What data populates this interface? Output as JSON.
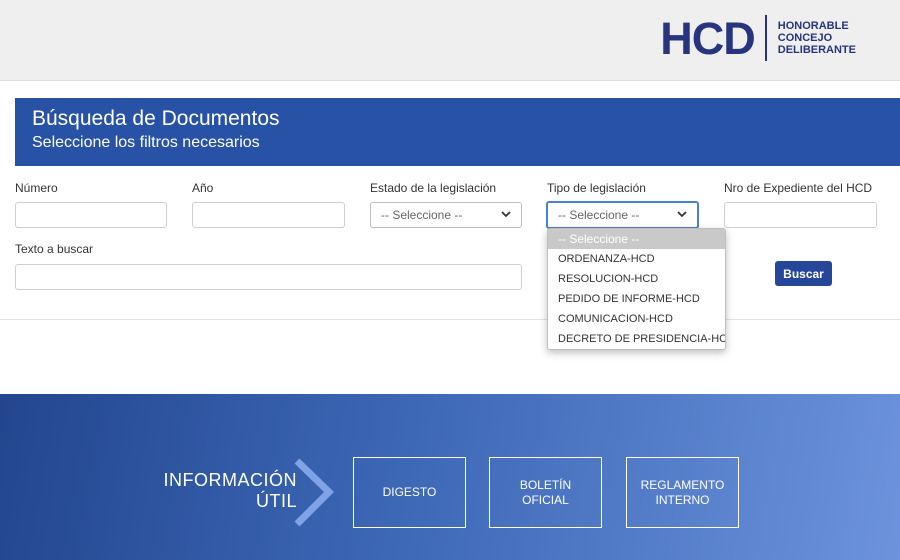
{
  "logo": {
    "mark": "HCD",
    "line1": "HONORABLE",
    "line2": "CONCEJO",
    "line3": "DELIBERANTE"
  },
  "banner": {
    "title": "Búsqueda de Documentos",
    "subtitle": "Seleccione los filtros necesarios"
  },
  "fields": {
    "numero": {
      "label": "Número",
      "value": ""
    },
    "anio": {
      "label": "Año",
      "value": ""
    },
    "estado": {
      "label": "Estado de la legislación",
      "selected": "-- Seleccione --"
    },
    "tipo": {
      "label": "Tipo de legislación",
      "selected": "-- Seleccione --"
    },
    "expediente": {
      "label": "Nro de Expediente del HCD",
      "value": ""
    },
    "texto": {
      "label": "Texto a buscar",
      "value": ""
    }
  },
  "buscar_label": "Buscar",
  "tipo_options": [
    "-- Seleccione --",
    "ORDENANZA-HCD",
    "RESOLUCION-HCD",
    "PEDIDO DE INFORME-HCD",
    "COMUNICACION-HCD",
    "DECRETO DE PRESIDENCIA-HCD"
  ],
  "footer": {
    "info_line1": "INFORMACIÓN",
    "info_line2": "ÚTIL",
    "links": [
      {
        "line1": "DIGESTO",
        "line2": ""
      },
      {
        "line1": "BOLETÍN",
        "line2": "OFICIAL"
      },
      {
        "line1": "REGLAMENTO",
        "line2": "INTERNO"
      }
    ]
  },
  "icons": {
    "select_arrow": "chevron-down-icon",
    "info_arrow": "chevron-right-icon"
  },
  "colors": {
    "brand": "#26357d",
    "banner": "#2852a6",
    "button": "#26469a",
    "focus": "#4a7fd6"
  }
}
